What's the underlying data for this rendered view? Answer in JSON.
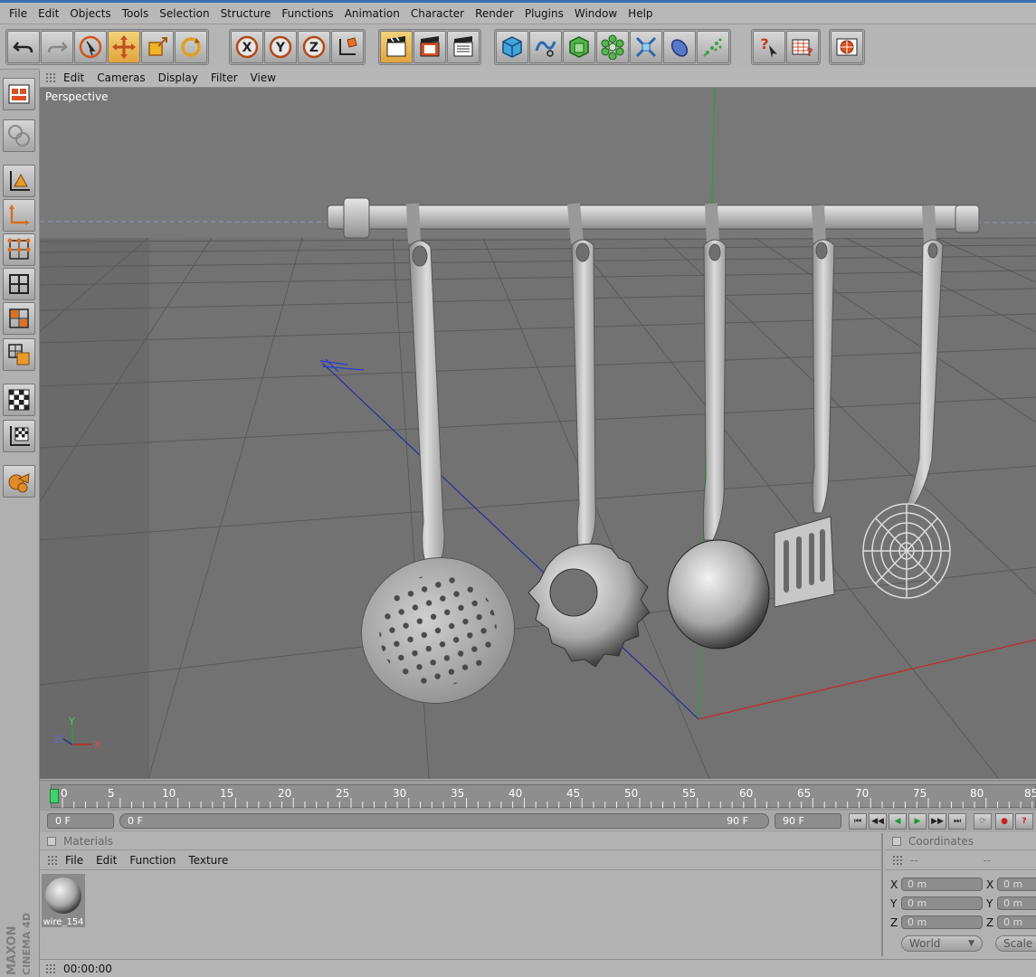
{
  "menubar": {
    "items": [
      "File",
      "Edit",
      "Objects",
      "Tools",
      "Selection",
      "Structure",
      "Functions",
      "Animation",
      "Character",
      "Render",
      "Plugins",
      "Window",
      "Help"
    ]
  },
  "toolbar": {
    "buttons": [
      "undo-icon",
      "redo-icon",
      "live-selection-icon",
      "move-icon",
      "scale-icon",
      "rotate-icon",
      "x-axis-icon",
      "y-axis-icon",
      "z-axis-icon",
      "world-coordinates-icon",
      "render-view-icon",
      "render-picture-viewer-icon",
      "render-settings-icon",
      "cube-icon",
      "spline-icon",
      "nurbs-icon",
      "array-icon",
      "deformer-icon",
      "scene-icon",
      "particle-icon",
      "help-pointer-icon",
      "info-table-icon",
      "layout-icon"
    ]
  },
  "viewport": {
    "menu": [
      "Edit",
      "Cameras",
      "Display",
      "Filter",
      "View"
    ],
    "label": "Perspective",
    "axis_labels": {
      "y": "Y",
      "z": "Z",
      "x": "X"
    }
  },
  "timeline": {
    "ticks": [
      "0",
      "5",
      "10",
      "15",
      "20",
      "25",
      "30",
      "35",
      "40",
      "45",
      "50",
      "55",
      "60",
      "65",
      "70",
      "75",
      "80",
      "85"
    ],
    "current_frame": "0 F",
    "min_frame": "0 F",
    "max_frame_inner": "90 F",
    "end_frame": "90 F"
  },
  "materials": {
    "title": "Materials",
    "menu": [
      "File",
      "Edit",
      "Function",
      "Texture"
    ],
    "items": [
      {
        "name": "wire_154"
      }
    ]
  },
  "coordinates": {
    "title": "Coordinates",
    "header_left": "--",
    "header_right": "--",
    "rows": [
      {
        "axis": "X",
        "value": "0 m",
        "axis2": "X",
        "value2": "0 m"
      },
      {
        "axis": "Y",
        "value": "0 m",
        "axis2": "Y",
        "value2": "0 m"
      },
      {
        "axis": "Z",
        "value": "0 m",
        "axis2": "Z",
        "value2": "0 m"
      }
    ],
    "space_dropdown": "World",
    "scale_dropdown": "Scale"
  },
  "status": {
    "time": "00:00:00"
  },
  "branding": {
    "line1": "MAXON",
    "line2": "CINEMA 4D"
  },
  "colors": {
    "accent": "#e8a53c",
    "viewport_bg": "#6f6f6f",
    "playhead": "#3fd46a",
    "x_axis": "#c62828",
    "y_axis": "#2e9e3a",
    "z_axis": "#2230a0"
  }
}
